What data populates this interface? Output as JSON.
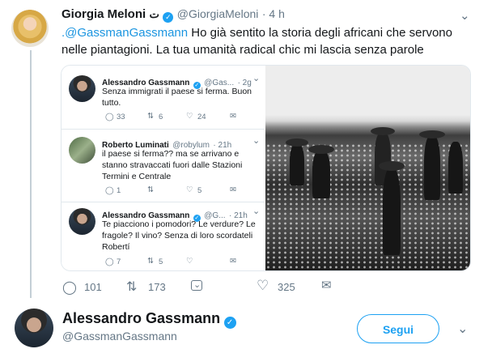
{
  "tweet": {
    "author_name": "Giorgia Meloni",
    "author_emoji": "ت",
    "author_handle": "@GiorgiaMeloni",
    "time": "· 4 h",
    "mention": ".@GassmanGassmann",
    "text": " Ho già sentito la storia degli africani che servono nelle piantagioni. La tua umanità radical chic mi lascia senza parole",
    "actions": {
      "reply_count": "101",
      "retweet_count": "173",
      "like_count": "325"
    }
  },
  "embed": {
    "tweets": [
      {
        "name": "Alessandro Gassmann",
        "handle": "@Gas...",
        "time": "· 2g",
        "text": "Senza immigrati il paese si ferma. Buon tutto.",
        "replies": "33",
        "retweets": "6",
        "likes": "24"
      },
      {
        "name": "Roberto Luminati",
        "handle": "@robylum",
        "time": "· 21h",
        "text": "il paese si ferma?? ma se arrivano e stanno stravaccati fuori dalle Stazioni Termini e Centrale",
        "replies": "1",
        "retweets": "",
        "likes": "5"
      },
      {
        "name": "Alessandro Gassmann",
        "handle": "@G...",
        "time": "· 21h",
        "text": "Te piacciono i pomodori? Le verdure? Le fragole? Il vino? Senza di loro scordateli Robertí",
        "replies": "7",
        "retweets": "5",
        "likes": ""
      }
    ]
  },
  "suggested_user": {
    "name": "Alessandro Gassmann",
    "handle": "@GassmanGassmann",
    "follow_label": "Segui"
  },
  "colors": {
    "accent": "#1da1f2",
    "link": "#1b95e0",
    "muted": "#657786"
  }
}
